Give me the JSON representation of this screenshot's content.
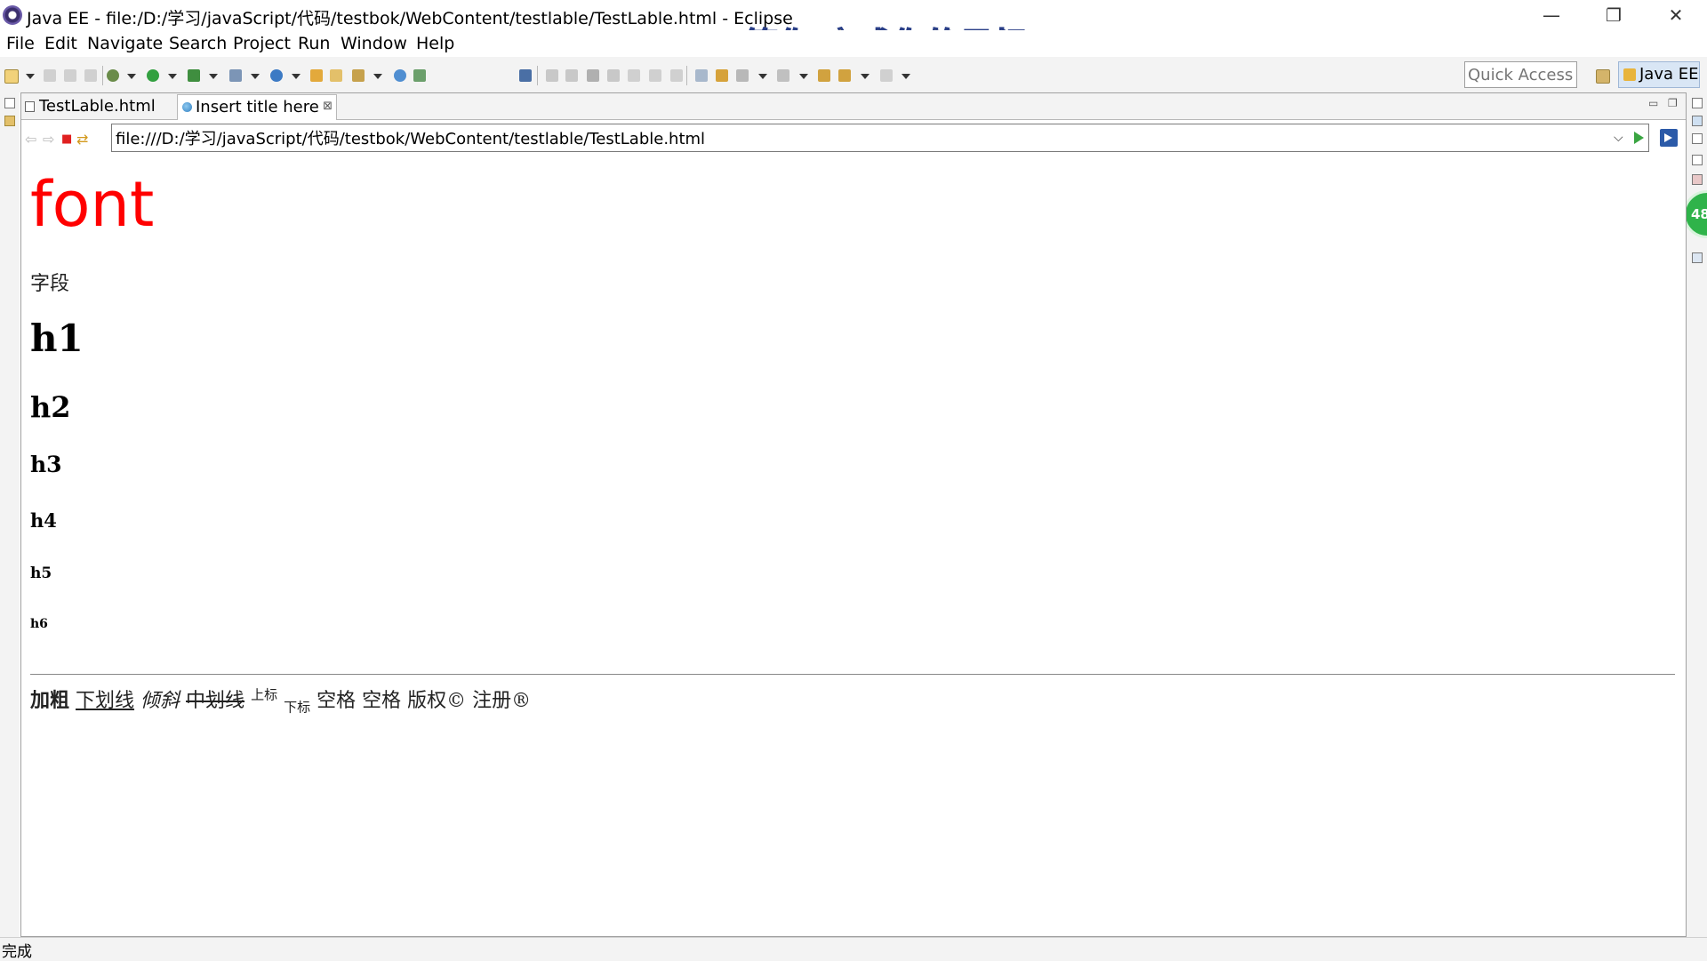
{
  "window": {
    "title": "Java EE - file:/D:/学习/javaScript/代码/testbok/WebContent/testlable/TestLable.html - Eclipse",
    "banner": "等你 完成你的目标",
    "minimize": "—",
    "restore": "❐",
    "close": "✕"
  },
  "menu": [
    "File",
    "Edit",
    "Navigate",
    "Search",
    "Project",
    "Run",
    "Window",
    "Help"
  ],
  "toolbar": {
    "quick_access_placeholder": "Quick Access",
    "perspective": "Java EE"
  },
  "tabs": [
    {
      "label": "TestLable.html",
      "active": false
    },
    {
      "label": "Insert title here",
      "active": true,
      "close": "⊠"
    }
  ],
  "browser": {
    "url": "file:///D:/学习/javaScript/代码/testbok/WebContent/testlable/TestLable.html",
    "back": "⇦",
    "forward": "⇨",
    "stop": "■",
    "refresh": "⇄",
    "dropdown": "⌵"
  },
  "content": {
    "font_text": "font",
    "font_color": "#ff0000",
    "field": "字段",
    "h1": "h1",
    "h2": "h2",
    "h3": "h3",
    "h4": "h4",
    "h5": "h5",
    "h6": "h6",
    "bold": "加粗",
    "underline": "下划线",
    "italic": "倾斜",
    "strike": "中划线",
    "superscript": "上标",
    "subscript": "下标",
    "space1": "空格",
    "space2": "空格",
    "copyright": "版权©",
    "registered": "注册®"
  },
  "badge": "48",
  "status": "完成"
}
